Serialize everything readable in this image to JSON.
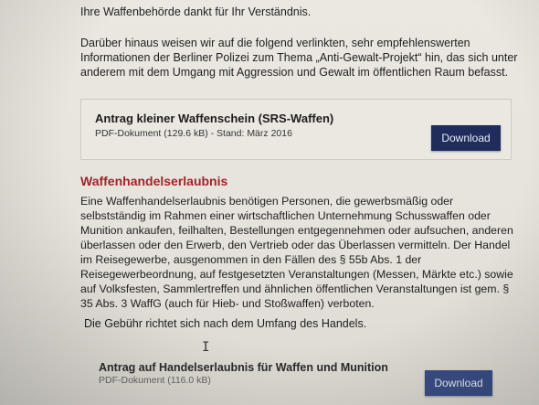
{
  "intro": {
    "thanks_text": "Ihre Waffenbehörde dankt für Ihr Verständnis.",
    "info_text": "Darüber hinaus weisen wir auf die folgend verlinkten, sehr empfehlenswerten Informationen der Berliner Polizei zum Thema „Anti-Gewalt-Projekt“ hin, das sich unter anderem mit dem Umgang mit Aggression und Gewalt im öffentlichen Raum befasst."
  },
  "download1": {
    "title": "Antrag kleiner Waffenschein (SRS-Waffen)",
    "meta": "PDF-Dokument (129.6 kB) - Stand: März 2016",
    "button_label": "Download"
  },
  "section": {
    "heading": "Waffenhandelserlaubnis",
    "body": "Eine Waffenhandelserlaubnis benötigen Personen, die gewerbsmäßig oder selbstständig im Rahmen einer wirtschaftlichen Unternehmung Schusswaffen oder Munition ankaufen, feilhalten, Bestellungen entgegennehmen oder aufsuchen, anderen überlassen oder den Erwerb, den Vertrieb oder das Überlassen vermitteln. Der Handel im Reisegewerbe, ausgenommen in den Fällen des § 55b Abs. 1 der Reisegewerbeordnung, auf festgesetzten Veranstaltungen (Messen, Märkte etc.) sowie auf Volksfesten, Sammlertreffen und ähnlichen öffentlichen Veranstaltungen ist gem. § 35 Abs. 3 WaffG (auch für Hieb- und Stoßwaffen) verboten.",
    "fee_text": "Die Gebühr richtet sich nach dem Umfang des Handels."
  },
  "download2": {
    "title": "Antrag auf Handelserlaubnis für Waffen und Munition",
    "meta": "PDF-Dokument (116.0 kB)",
    "button_label": "Download"
  },
  "cursor": {
    "icon": "text-cursor-icon",
    "glyph": "I"
  },
  "colors": {
    "heading": "#a3232b",
    "button": "#1f2c5c",
    "background": "#e9e6df"
  }
}
